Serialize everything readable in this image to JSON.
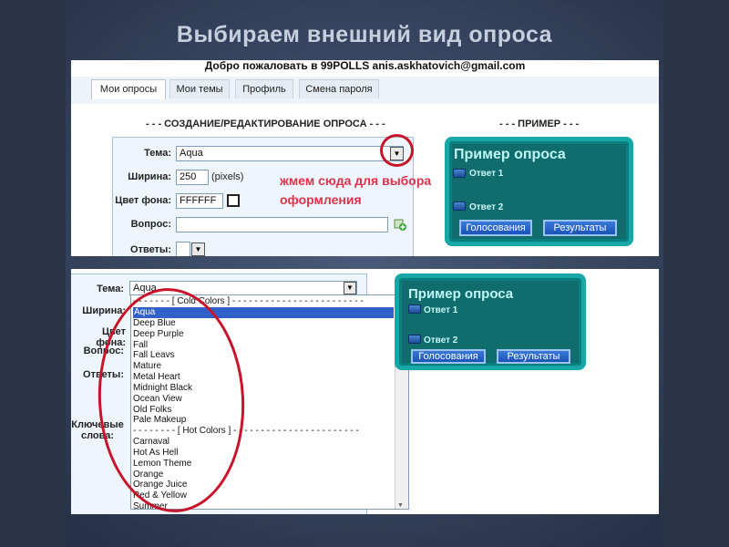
{
  "slide_title": "Выбираем внешний вид опроса",
  "panel1": {
    "welcome": "Добро пожаловать в 99POLLS anis.askhatovich@gmail.com",
    "tabs": [
      "Мои опросы",
      "Мои темы",
      "Профиль",
      "Смена пароля"
    ],
    "section_create": "- - - СОЗДАНИЕ/РЕДАКТИРОВАНИЕ ОПРОСА - - -",
    "section_example": "- - - ПРИМЕР - - -",
    "form": {
      "theme_label": "Тема:",
      "theme_value": "Aqua",
      "width_label": "Ширина:",
      "width_value": "250",
      "width_unit": "(pixels)",
      "bg_label": "Цвет фона:",
      "bg_value": "FFFFFF",
      "question_label": "Вопрос:",
      "answers_label": "Ответы:"
    },
    "hint_line1": "жмем сюда для выбора",
    "hint_line2": "оформления",
    "poll": {
      "title": "Пример опроса",
      "answer1": "Ответ 1",
      "answer2": "Ответ 2",
      "vote_button": "Голосования",
      "results_button": "Результаты"
    }
  },
  "panel2": {
    "theme_label": "Тема:",
    "theme_value": "Aqua",
    "width_label": "Ширина:",
    "bg_label": "Цвет фона:",
    "question_label": "Вопрос:",
    "answers_label": "Ответы:",
    "keywords_label_1": "Ключевые",
    "keywords_label_2": "слова:",
    "options": [
      "- - - - - - - [ Cold Colors ] - - - - - - - - - - - - - - - - - - - - - - - -",
      "Aqua",
      "Deep Blue",
      "Deep Purple",
      "Fall",
      "Fall Leavs",
      "Mature",
      "Metal Heart",
      "Midnight Black",
      "Ocean View",
      "Old Folks",
      "Pale Makeup",
      "- - - - - - - - [ Hot Colors ] - - - - - - - - - - - - - - - - - - - - - - -",
      "Carnaval",
      "Hot As Hell",
      "Lemon Theme",
      "Orange",
      "Orange Juice",
      "Red & Yellow",
      "Summer"
    ],
    "poll": {
      "title": "Пример опроса",
      "answer1": "Ответ 1",
      "answer2": "Ответ 2",
      "vote_button": "Голосования",
      "results_button": "Результаты"
    }
  },
  "colors": {
    "accent_red": "#c8142b",
    "poll_teal": "#0a7f7f",
    "selection_blue": "#3160c9"
  }
}
